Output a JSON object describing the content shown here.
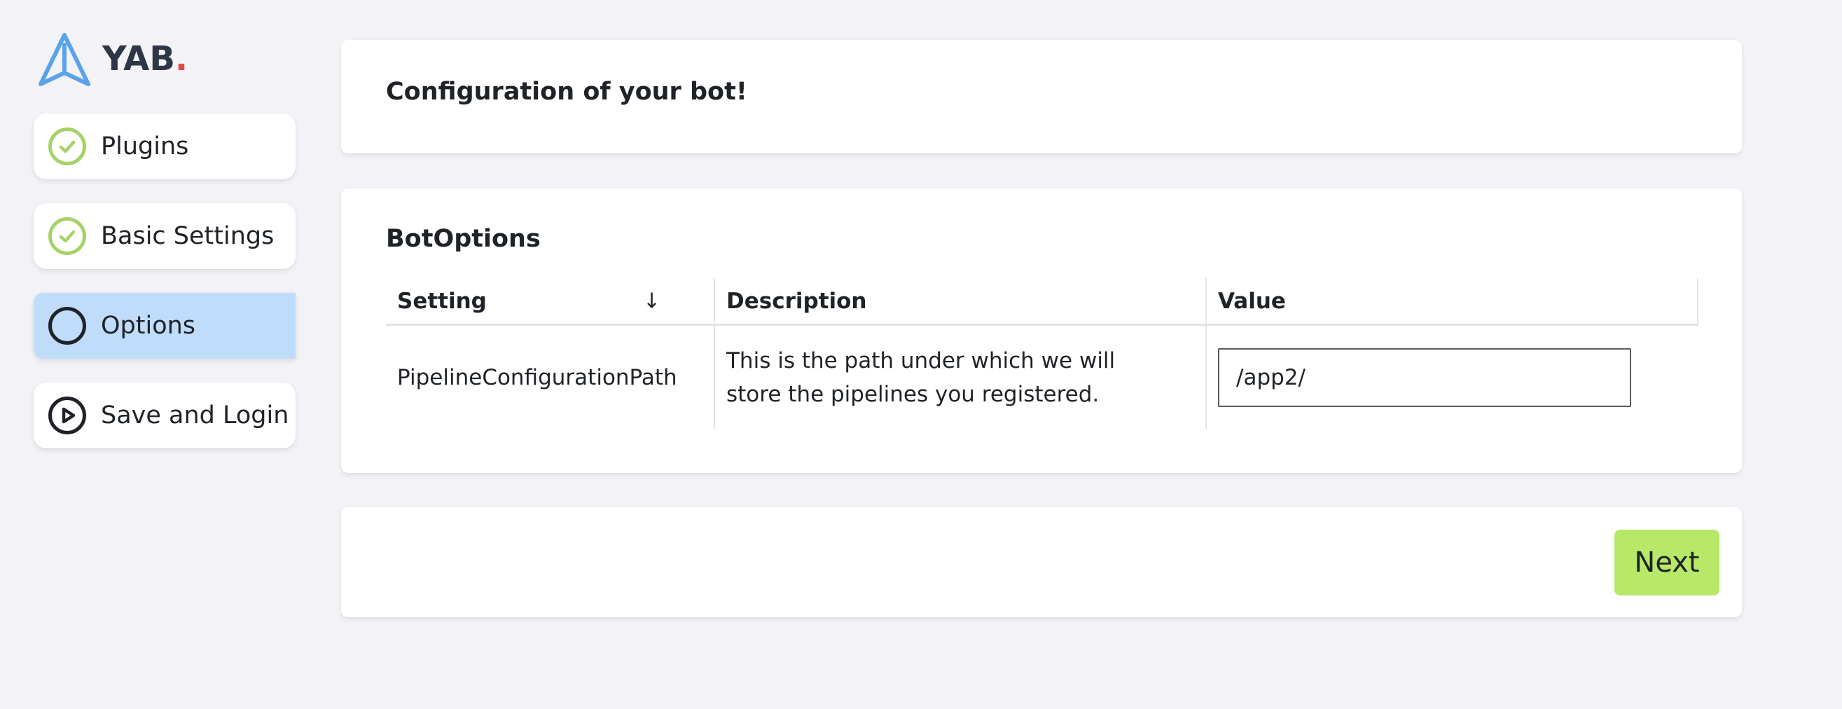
{
  "app": {
    "logo_text": "YAB",
    "logo_dot": "."
  },
  "sidebar": {
    "steps": [
      {
        "label": "Plugins",
        "status": "complete",
        "icon": "check-circle-icon"
      },
      {
        "label": "Basic Settings",
        "status": "complete",
        "icon": "check-circle-icon"
      },
      {
        "label": "Options",
        "status": "current",
        "icon": "empty-circle-icon"
      },
      {
        "label": "Save and Login",
        "status": "pending",
        "icon": "play-circle-icon"
      }
    ]
  },
  "header_card": {
    "title": "Configuration of your bot!"
  },
  "options_card": {
    "title": "BotOptions",
    "columns": [
      "Setting",
      "Description",
      "Value"
    ],
    "sort_indicator": "↓",
    "rows": [
      {
        "setting": "PipelineConfigurationPath",
        "description": "This is the path under which we will store the pipelines you registered.",
        "value": "/app2/"
      }
    ]
  },
  "footer_card": {
    "next_label": "Next"
  },
  "colors": {
    "background": "#f2f2f7",
    "active_step": "#c0dcfb",
    "complete_icon": "#a6d26a",
    "next_button": "#b8e868",
    "logo_blue": "#5aa3ea",
    "logo_dot": "#e5484d"
  }
}
